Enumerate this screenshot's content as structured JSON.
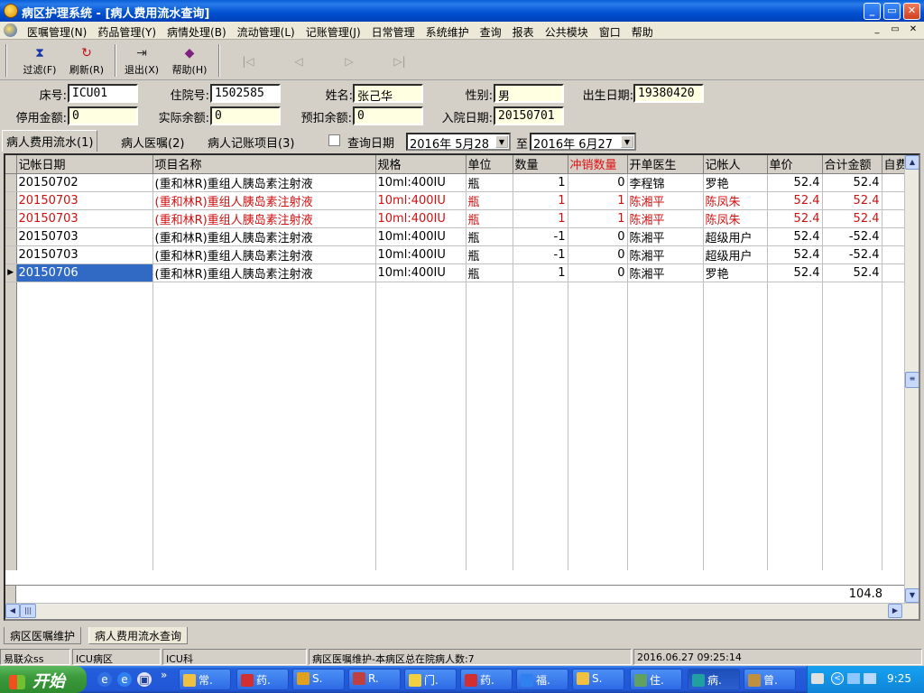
{
  "window": {
    "title": "病区护理系统 - [病人费用流水查询]",
    "btn_min": "_",
    "btn_max": "▭",
    "btn_close": "✕"
  },
  "menu": {
    "items": [
      "医嘱管理(N)",
      "药品管理(Y)",
      "病情处理(B)",
      "流动管理(L)",
      "记账管理(J)",
      "日常管理",
      "系统维护",
      "查询",
      "报表",
      "公共模块",
      "窗口",
      "帮助"
    ],
    "mdi_min": "_",
    "mdi_restore": "▭",
    "mdi_close": "✕"
  },
  "toolbar": {
    "filter": "过滤(F)",
    "refresh": "刷新(R)",
    "exit": "退出(X)",
    "help": "帮助(H)"
  },
  "patient": {
    "bed_label": "床号:",
    "bed": "ICU01",
    "admission_no_label": "住院号:",
    "admission_no": "1502585",
    "name_label": "姓名:",
    "name": "张己华",
    "gender_label": "性别:",
    "gender": "男",
    "dob_label": "出生日期:",
    "dob": "19380420",
    "stopped_amount_label": "停用金额:",
    "stopped_amount": "0",
    "actual_balance_label": "实际余额:",
    "actual_balance": "0",
    "prededuct_balance_label": "预扣余额:",
    "prededuct_balance": "0",
    "admit_date_label": "入院日期:",
    "admit_date": "20150701"
  },
  "tabs": {
    "fee_flow": "病人费用流水(1)",
    "orders": "病人医嘱(2)",
    "billing_items": "病人记账项目(3)",
    "query_date_label": "查询日期",
    "date_from": "2016年 5月28",
    "date_to_label": "至",
    "date_to": "2016年 6月27"
  },
  "grid": {
    "headers": {
      "date": "记帐日期",
      "item": "项目名称",
      "spec": "规格",
      "unit": "单位",
      "qty": "数量",
      "reversal": "冲销数量",
      "doctor": "开单医生",
      "clerk": "记帐人",
      "price": "单价",
      "total": "合计金额",
      "self": "自费"
    },
    "rows": [
      {
        "date": "20150702",
        "item": "(重和林R)重组人胰岛素注射液",
        "spec": "10ml:400IU",
        "unit": "瓶",
        "qty": "1",
        "reversal": "0",
        "doctor": "李程锦",
        "clerk": "罗艳",
        "price": "52.4",
        "total": "52.4"
      },
      {
        "date": "20150703",
        "item": "(重和林R)重组人胰岛素注射液",
        "spec": "10ml:400IU",
        "unit": "瓶",
        "qty": "1",
        "reversal": "1",
        "doctor": "陈湘平",
        "clerk": "陈凤朱",
        "price": "52.4",
        "total": "52.4"
      },
      {
        "date": "20150703",
        "item": "(重和林R)重组人胰岛素注射液",
        "spec": "10ml:400IU",
        "unit": "瓶",
        "qty": "1",
        "reversal": "1",
        "doctor": "陈湘平",
        "clerk": "陈凤朱",
        "price": "52.4",
        "total": "52.4"
      },
      {
        "date": "20150703",
        "item": "(重和林R)重组人胰岛素注射液",
        "spec": "10ml:400IU",
        "unit": "瓶",
        "qty": "-1",
        "reversal": "0",
        "doctor": "陈湘平",
        "clerk": "超级用户",
        "price": "52.4",
        "total": "-52.4"
      },
      {
        "date": "20150703",
        "item": "(重和林R)重组人胰岛素注射液",
        "spec": "10ml:400IU",
        "unit": "瓶",
        "qty": "-1",
        "reversal": "0",
        "doctor": "陈湘平",
        "clerk": "超级用户",
        "price": "52.4",
        "total": "-52.4"
      },
      {
        "date": "20150706",
        "item": "(重和林R)重组人胰岛素注射液",
        "spec": "10ml:400IU",
        "unit": "瓶",
        "qty": "1",
        "reversal": "0",
        "doctor": "陈湘平",
        "clerk": "罗艳",
        "price": "52.4",
        "total": "52.4"
      }
    ],
    "row_styles": [
      "normal",
      "red",
      "red",
      "normal",
      "normal",
      "normal"
    ],
    "current_row_marker": "▶",
    "footer_total": "104.8"
  },
  "bottom_tabs": {
    "orders_maint": "病区医嘱维护",
    "fee_flow_query": "病人费用流水查询"
  },
  "status": {
    "user": "易联众ss",
    "ward": "ICU病区",
    "dept": "ICU科",
    "message": "病区医嘱维护-本病区总在院病人数:7",
    "datetime": "2016.06.27 09:25:14"
  },
  "taskbar": {
    "start": "开始",
    "tasks": [
      "常.",
      "药.",
      "S.",
      "R.",
      "门.",
      "药.",
      "福.",
      "S.",
      "住.",
      "病.",
      "曾."
    ],
    "clock": "9:25"
  },
  "colors": {
    "title_blue": "#0050d0",
    "reversal_red": "#d01010",
    "selection_blue": "#316ac5",
    "field_yellow": "#ffffe1"
  }
}
